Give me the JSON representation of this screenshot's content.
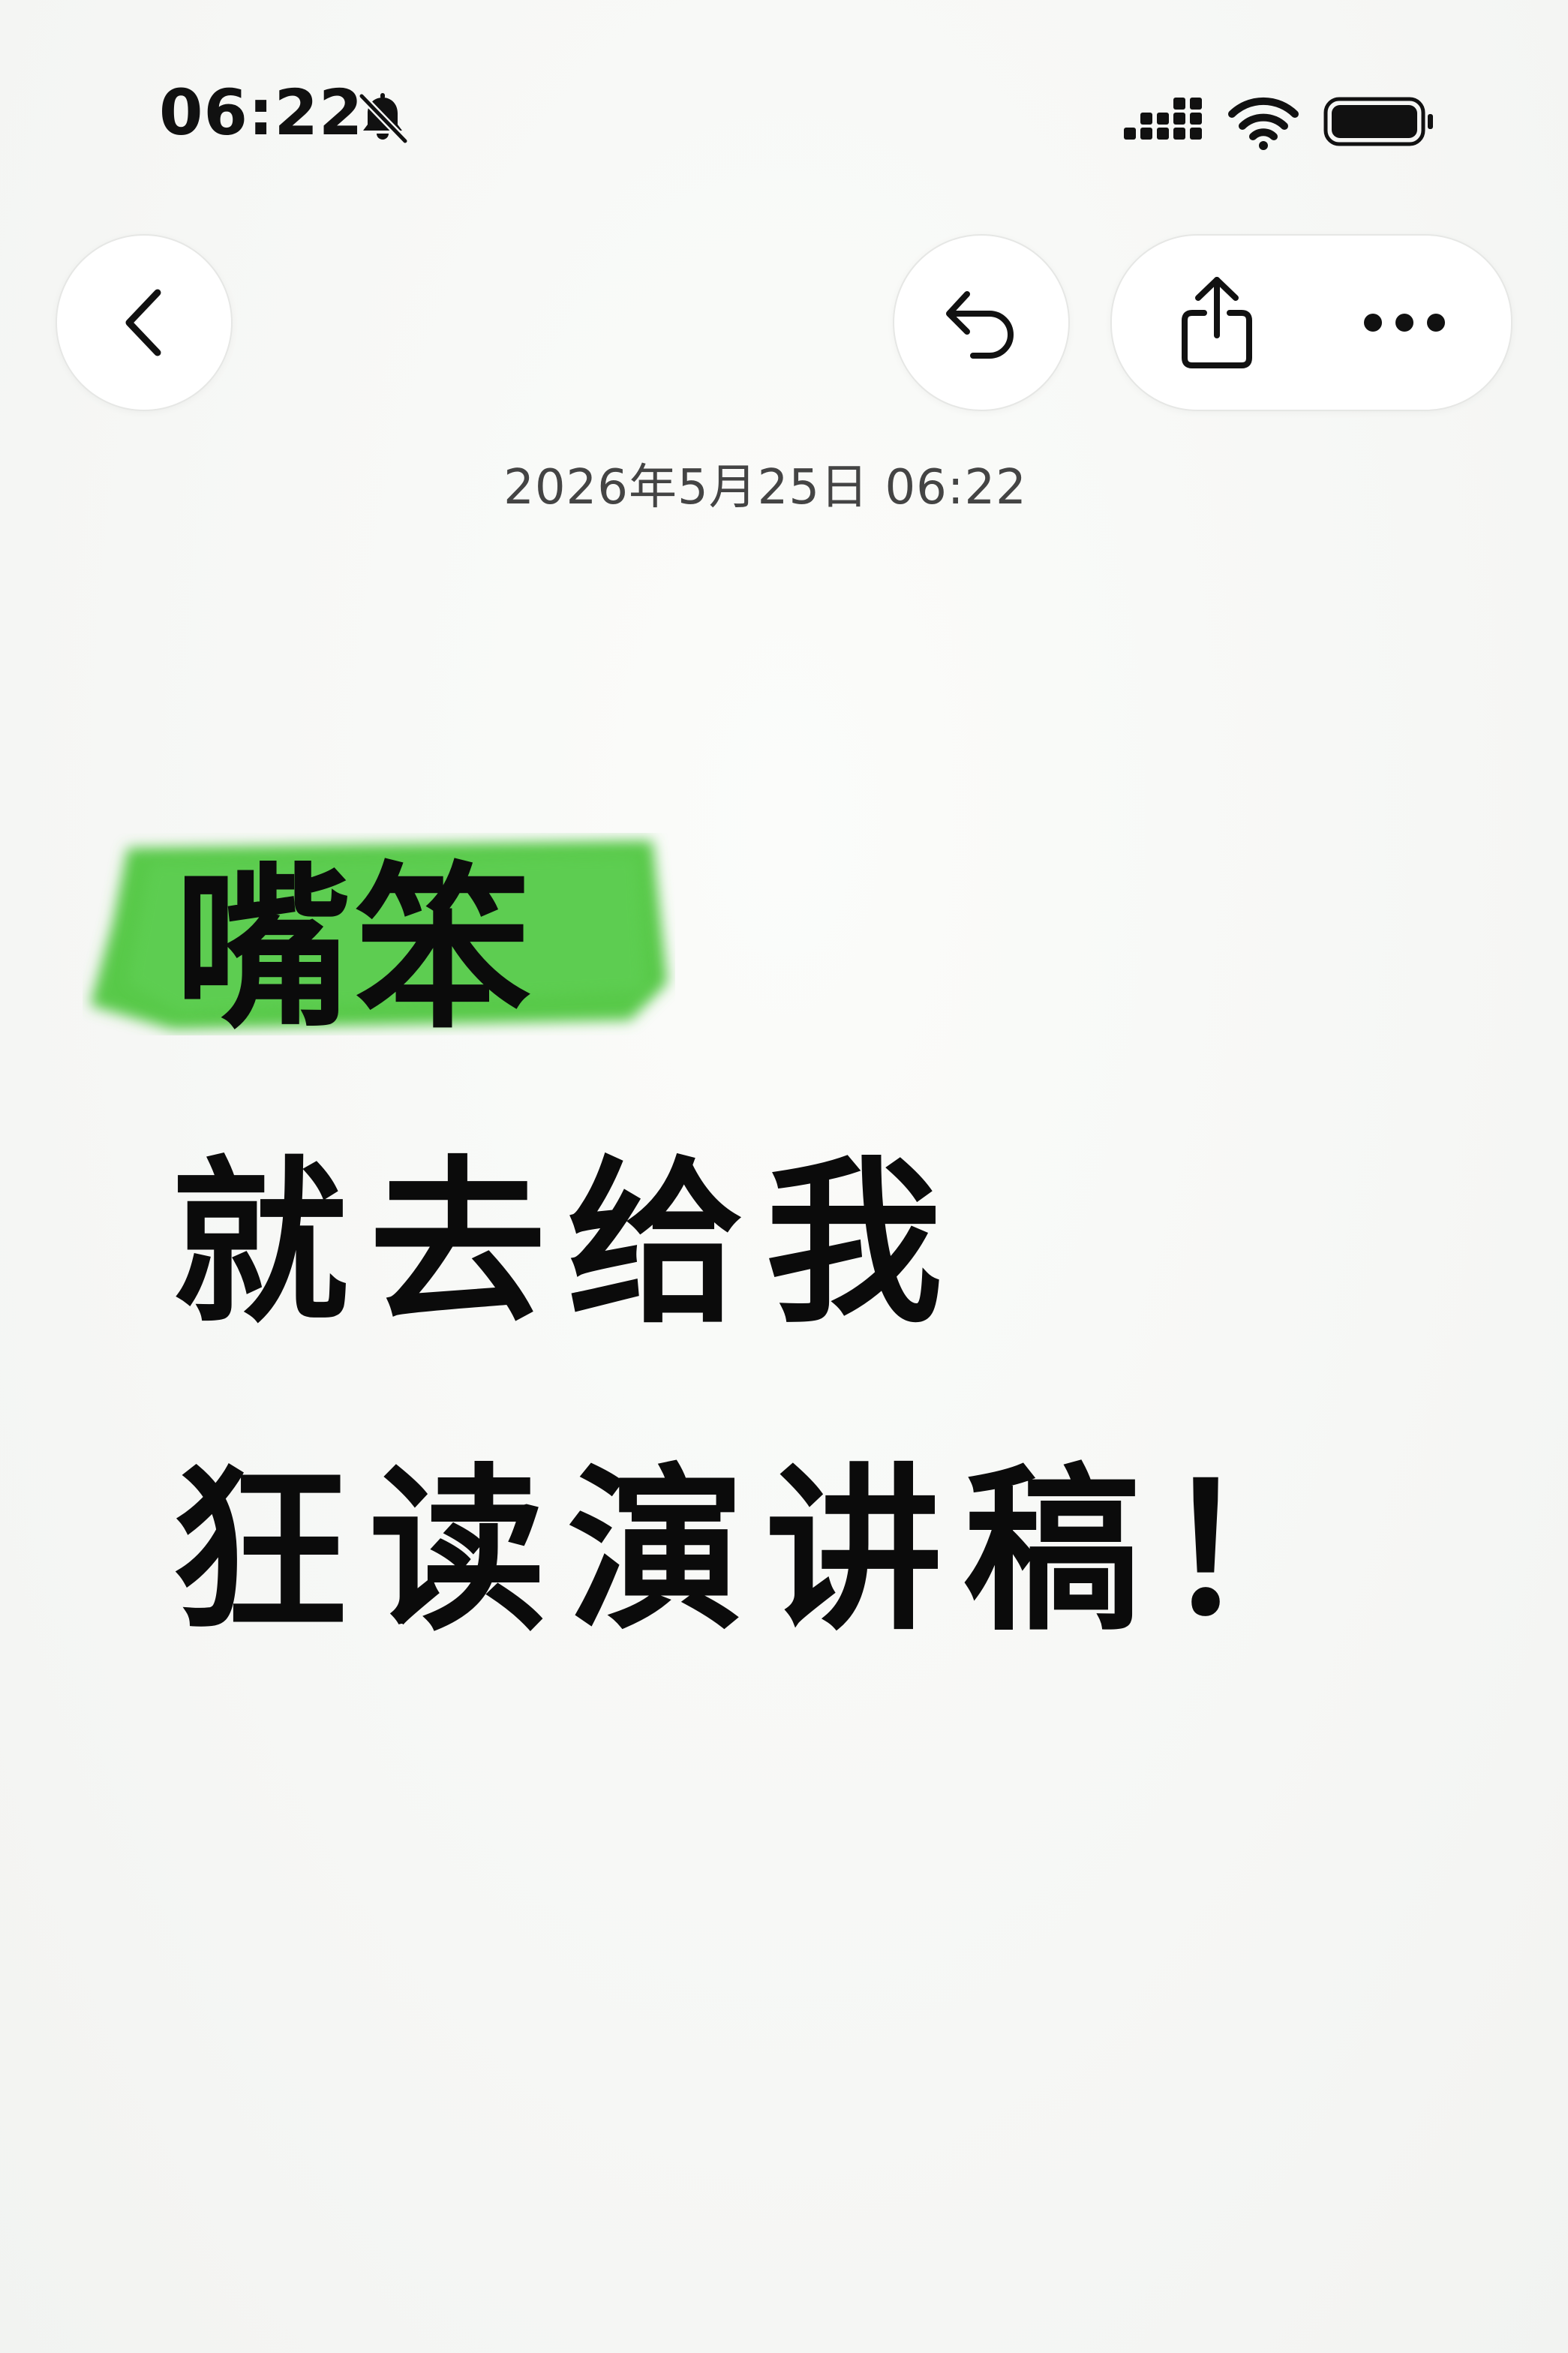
{
  "status_bar": {
    "time": "06:22",
    "icons": [
      "bell-slash-icon",
      "cellular-signal-icon",
      "wifi-icon",
      "battery-icon"
    ]
  },
  "toolbar": {
    "icons": [
      "chevron-left-icon",
      "undo-icon",
      "share-icon",
      "ellipsis-icon"
    ]
  },
  "note": {
    "date": "2026年5月25日 06:22",
    "lines": [
      "嘴笨",
      "就去给我",
      "狂读演讲稿！"
    ],
    "highlight_color": "#58c94a"
  }
}
